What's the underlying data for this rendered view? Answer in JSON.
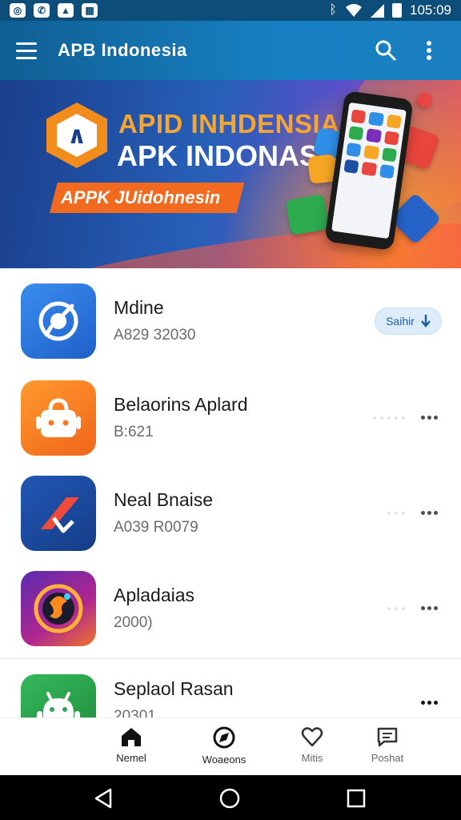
{
  "status_bar": {
    "time": "105:09",
    "left_icons": [
      "camera-icon",
      "whatsapp-icon",
      "image-icon",
      "calendar-icon"
    ],
    "right_icons": [
      "bluetooth-icon",
      "wifi-icon",
      "signal-icon",
      "battery-icon"
    ]
  },
  "app_bar": {
    "title": "APB Indonesia",
    "actions": [
      "search-icon",
      "more-vert-icon"
    ]
  },
  "banner": {
    "line1": "APID INHDENSIA",
    "line2": "APK INDONASIA",
    "ribbon": "APPK JUidohnesin"
  },
  "apps": [
    {
      "name": "Mdine",
      "subtitle": "A829 32030",
      "action": "Saihir",
      "icon": "compass-chat-icon",
      "color": "#2f7fe0"
    },
    {
      "name": "Belaorins Aplard",
      "subtitle": "B:621",
      "action": "",
      "icon": "robot-bag-icon",
      "color": "#f57a1f"
    },
    {
      "name": "Neal Bnaise",
      "subtitle": "A039 R0079",
      "action": "",
      "icon": "arrow-logo-icon",
      "color": "#1f4fa3"
    },
    {
      "name": "Apladaias",
      "subtitle": "2000)",
      "action": "",
      "icon": "swirl-logo-icon",
      "color": "#7a2fb8"
    },
    {
      "name": "Seplaol Rasan",
      "subtitle": "20301",
      "action": "",
      "icon": "android-icon",
      "color": "#2ea84e"
    }
  ],
  "bottom_nav": [
    {
      "label": "Nemel",
      "icon": "home-icon",
      "active": true
    },
    {
      "label": "Woaeons",
      "icon": "compass-icon",
      "active": false
    },
    {
      "label": "Mitis",
      "icon": "heart-icon",
      "active": false
    },
    {
      "label": "Poshat",
      "icon": "message-icon",
      "active": false
    }
  ],
  "system_nav": [
    "back-icon",
    "home-circle-icon",
    "recents-icon"
  ],
  "colors": {
    "app_bar": "#1780c2",
    "status_bar": "#0d4d7a",
    "accent_orange": "#f26a1f",
    "install_pill": "#dcecf8"
  }
}
